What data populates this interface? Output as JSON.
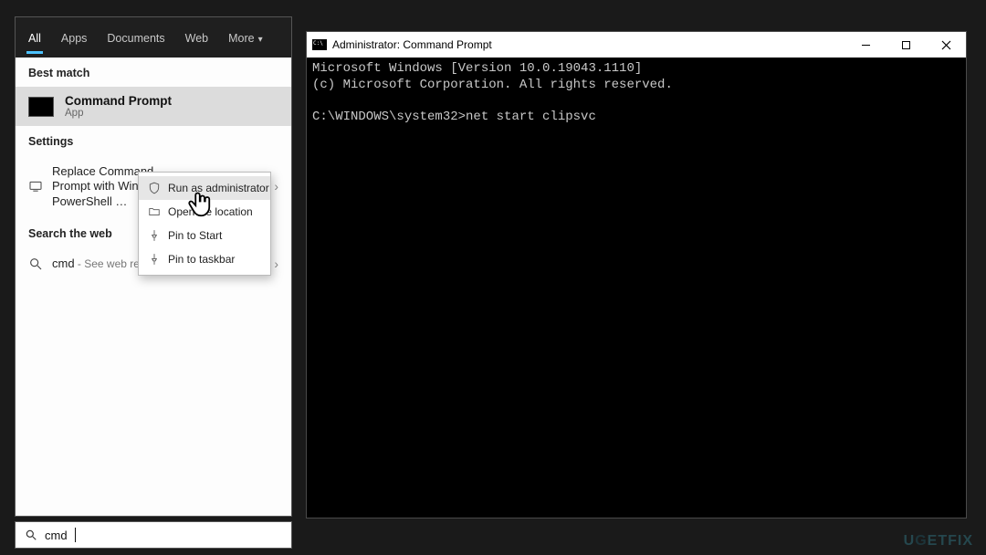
{
  "search": {
    "tabs": {
      "all": "All",
      "apps": "Apps",
      "documents": "Documents",
      "web": "Web",
      "more": "More"
    },
    "sections": {
      "best_match": "Best match",
      "settings": "Settings",
      "search_web": "Search the web"
    },
    "best_match": {
      "title": "Command Prompt",
      "subtitle": "App"
    },
    "settings_row": "Replace Command Prompt with Windows PowerShell …",
    "web_row": {
      "term": "cmd",
      "suffix": " - See web results"
    },
    "query": "cmd"
  },
  "context_menu": {
    "run_admin": "Run as administrator",
    "open_location": "Open file location",
    "pin_start": "Pin to Start",
    "pin_taskbar": "Pin to taskbar"
  },
  "cmd_window": {
    "title": "Administrator: Command Prompt",
    "line1": "Microsoft Windows [Version 10.0.19043.1110]",
    "line2": "(c) Microsoft Corporation. All rights reserved.",
    "prompt": "C:\\WINDOWS\\system32>",
    "command": "net start clipsvc"
  },
  "watermark": "UGETFIX"
}
